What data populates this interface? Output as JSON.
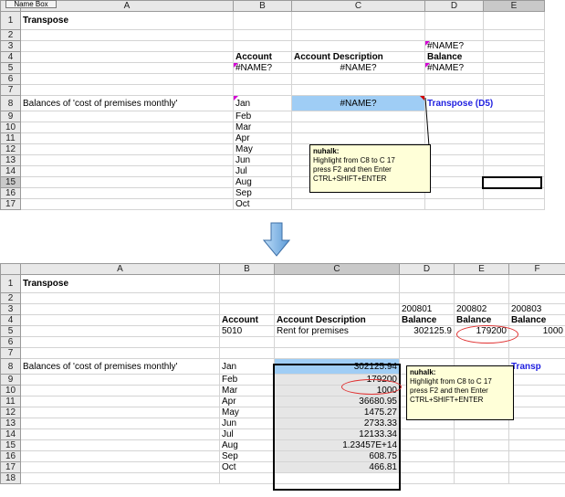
{
  "top": {
    "name_box": "Name Box",
    "cols": [
      "A",
      "B",
      "C",
      "D",
      "E"
    ],
    "rows": [
      "1",
      "2",
      "3",
      "4",
      "5",
      "6",
      "7",
      "8",
      "9",
      "10",
      "11",
      "12",
      "13",
      "14",
      "15",
      "16",
      "17"
    ],
    "title": "Transpose",
    "d3": "#NAME?",
    "b4": "Account",
    "c4": "Account Description",
    "d4": "Balance",
    "b5": "#NAME?",
    "c5": "#NAME?",
    "d5": "#NAME?",
    "a8": "Balances of 'cost of premises monthly'",
    "c8": "#NAME?",
    "d8_label": "Transpose (D5)",
    "months": [
      "Jan",
      "Feb",
      "Mar",
      "Apr",
      "May",
      "Jun",
      "Jul",
      "Aug",
      "Sep",
      "Oct"
    ],
    "note_author": "nuhalk:",
    "note_text": [
      "Highlight from C8 to C 17",
      "press F2 and then Enter",
      "CTRL+SHIFT+ENTER"
    ]
  },
  "arrow": "down-arrow-icon",
  "bottom": {
    "cols": [
      "A",
      "B",
      "C",
      "D",
      "E",
      "F"
    ],
    "rows": [
      "1",
      "2",
      "3",
      "4",
      "5",
      "6",
      "7",
      "8",
      "9",
      "10",
      "11",
      "12",
      "13",
      "14",
      "15",
      "16",
      "17",
      "18"
    ],
    "title": "Transpose",
    "d3": "200801",
    "e3": "200802",
    "f3": "200803",
    "b4": "Account",
    "c4": "Account Description",
    "d4": "Balance",
    "e4": "Balance",
    "f4": "Balance",
    "b5": "5010",
    "c5": "Rent for premises",
    "d5": "302125.9",
    "e5": "179200",
    "f5": "1000",
    "a8": "Balances of 'cost of premises monthly'",
    "f8_label": "Transp",
    "months": [
      "Jan",
      "Feb",
      "Mar",
      "Apr",
      "May",
      "Jun",
      "Jul",
      "Aug",
      "Sep",
      "Oct"
    ],
    "values": [
      "302125.94",
      "179200",
      "1000",
      "36680.95",
      "1475.27",
      "2733.33",
      "12133.34",
      "1.23457E+14",
      "608.75",
      "466.81"
    ],
    "note_author": "nuhalk:",
    "note_text": [
      "Highlight from C8 to C 17",
      "press F2 and then Enter",
      "CTRL+SHIFT+ENTER"
    ]
  }
}
